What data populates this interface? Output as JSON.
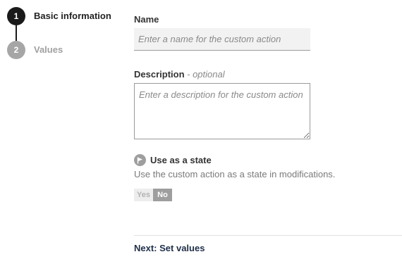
{
  "stepper": {
    "steps": [
      {
        "number": "1",
        "label": "Basic information",
        "state": "active"
      },
      {
        "number": "2",
        "label": "Values",
        "state": "inactive"
      }
    ]
  },
  "form": {
    "name": {
      "label": "Name",
      "placeholder": "Enter a name for the custom action",
      "value": ""
    },
    "description": {
      "label": "Description",
      "optional": "- optional",
      "placeholder": "Enter a description for the custom action",
      "value": ""
    },
    "state": {
      "icon": "flag-icon",
      "title": "Use as a state",
      "description": "Use the custom action as a state in modifications.",
      "options": [
        "Yes",
        "No"
      ],
      "selected": "No"
    }
  },
  "footer": {
    "next_label": "Next: Set values"
  },
  "colors": {
    "active_step": "#1a1a1a",
    "inactive_step": "#a6a6a6",
    "toggle_selected": "#9e9e9e",
    "link": "#1f2f4a"
  }
}
